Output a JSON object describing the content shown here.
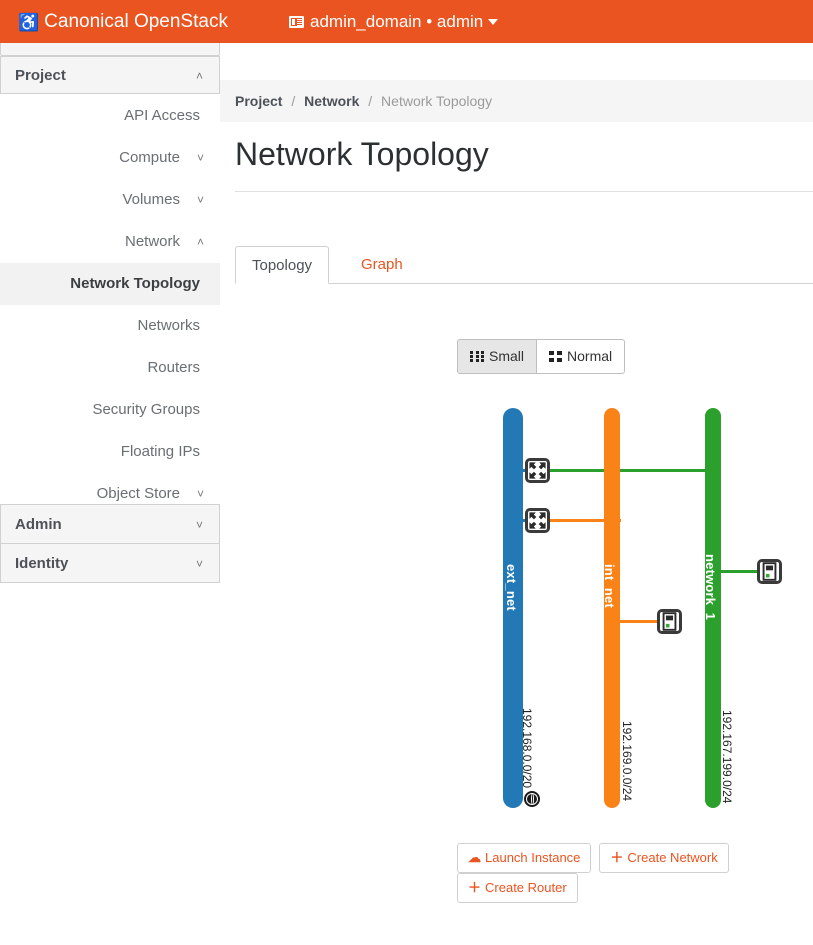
{
  "navbar": {
    "brand": "Canonical OpenStack",
    "brand_icon": "openstack-logo-icon",
    "context_switcher": "admin_domain • admin",
    "context_icon": "domain-list-icon",
    "caret_icon": "caret-down-icon"
  },
  "sidebar": {
    "sections": [
      {
        "label": "Project",
        "chevron": "˄",
        "state": "expanded"
      },
      {
        "label": "Admin",
        "chevron": "˅",
        "state": "collapsed"
      },
      {
        "label": "Identity",
        "chevron": "˅",
        "state": "collapsed"
      }
    ],
    "project_items": [
      {
        "label": "API Access",
        "chevron": "",
        "active": false
      },
      {
        "label": "Compute",
        "chevron": "˅",
        "active": false
      },
      {
        "label": "Volumes",
        "chevron": "˅",
        "active": false
      },
      {
        "label": "Network",
        "chevron": "˄",
        "active": false
      },
      {
        "label": "Network Topology",
        "chevron": "",
        "active": true
      },
      {
        "label": "Networks",
        "chevron": "",
        "active": false
      },
      {
        "label": "Routers",
        "chevron": "",
        "active": false
      },
      {
        "label": "Security Groups",
        "chevron": "",
        "active": false
      },
      {
        "label": "Floating IPs",
        "chevron": "",
        "active": false
      },
      {
        "label": "Object Store",
        "chevron": "˅",
        "active": false
      }
    ]
  },
  "breadcrumb": {
    "items": [
      "Project",
      "Network",
      "Network Topology"
    ],
    "separator": "/"
  },
  "page": {
    "title": "Network Topology"
  },
  "tabs": [
    {
      "label": "Topology",
      "active": true
    },
    {
      "label": "Graph",
      "active": false
    }
  ],
  "size_toggle": {
    "options": [
      {
        "label": "Small",
        "icon": "grid-small-icon",
        "selected": true
      },
      {
        "label": "Normal",
        "icon": "grid-normal-icon",
        "selected": false
      }
    ]
  },
  "topology": {
    "networks": [
      {
        "name": "ext_net",
        "cidr": "192.168.0.0/20",
        "color": "#2279b5",
        "external": true,
        "external_icon": "globe-icon"
      },
      {
        "name": "int_net",
        "cidr": "192.169.0.0/24",
        "color": "#f98316",
        "external": false,
        "external_icon": ""
      },
      {
        "name": "network_1",
        "cidr": "192.167.199.0/24",
        "color": "#2ca02c",
        "external": false,
        "external_icon": ""
      }
    ],
    "routers": [
      {
        "icon": "router-icon",
        "connects": [
          "ext_net",
          "network_1"
        ]
      },
      {
        "icon": "router-icon",
        "connects": [
          "ext_net",
          "int_net"
        ]
      }
    ],
    "instances": [
      {
        "icon": "server-instance-icon",
        "network": "network_1"
      },
      {
        "icon": "server-instance-icon",
        "network": "int_net"
      }
    ]
  },
  "actions": [
    {
      "label": "Launch Instance",
      "icon": "cloud-upload-icon",
      "glyph": "☁"
    },
    {
      "label": "Create Network",
      "icon": "plus-icon",
      "glyph": "＋"
    },
    {
      "label": "Create Router",
      "icon": "plus-icon",
      "glyph": "＋"
    }
  ],
  "colors": {
    "brand_orange": "#e95420",
    "link_orange": "#e95420",
    "net_blue": "#2279b5",
    "net_orange": "#f98316",
    "net_green": "#2ca02c"
  }
}
